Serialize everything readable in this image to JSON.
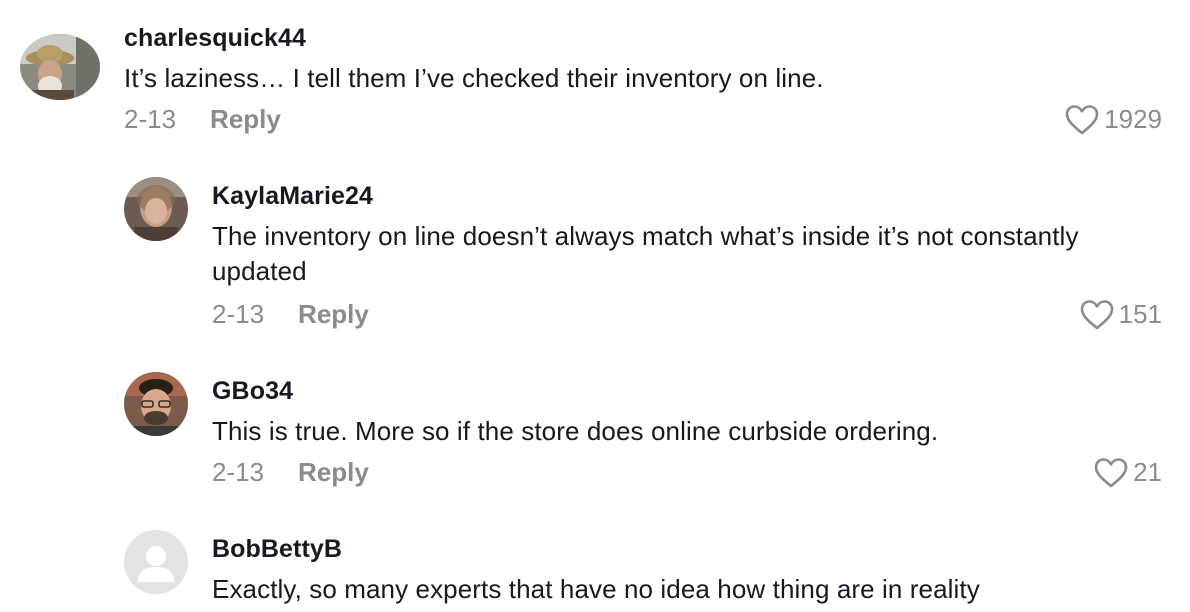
{
  "comments": [
    {
      "username": "charlesquick44",
      "text": "It’s laziness… I tell them I’ve checked their inventory on line.",
      "date": "2-13",
      "reply_label": "Reply",
      "likes": "1929"
    },
    {
      "username": "KaylaMarie24",
      "text": "The inventory on line doesn’t always match what’s inside it’s not constantly updated",
      "date": "2-13",
      "reply_label": "Reply",
      "likes": "151"
    },
    {
      "username": "GBo34",
      "text": "This is true. More so if the store does online curbside ordering.",
      "date": "2-13",
      "reply_label": "Reply",
      "likes": "21"
    },
    {
      "username": "BobBettyB",
      "text": "Exactly, so many experts that have no idea how thing are in reality"
    }
  ],
  "colors": {
    "text": "#161823",
    "secondary": "#8a8b91"
  }
}
